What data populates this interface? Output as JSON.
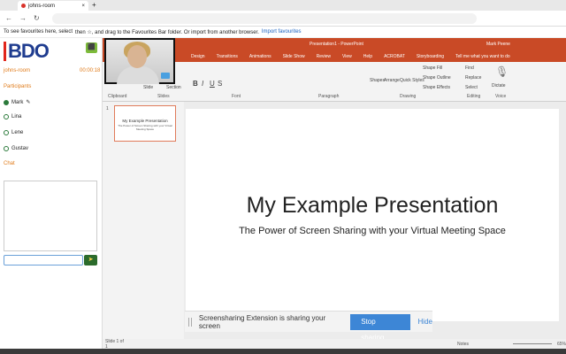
{
  "browser": {
    "tab_title": "johns-room",
    "back_icon": "←",
    "forward_icon": "→",
    "reload_icon": "↻",
    "fav_text": "To see favourites here, select",
    "fav_text2": "then ☆, and drag to the Favourites Bar folder. Or import from another browser.",
    "fav_link": "Import favourites"
  },
  "sidebar": {
    "logo": "BDO",
    "room": "johns-room",
    "timer": "00:00:18",
    "participants_label": "Participants",
    "participants": [
      "Mark",
      "Lina",
      "Lene",
      "Gustav"
    ],
    "chat_label": "Chat"
  },
  "ppt": {
    "title": "Presentation1 - PowerPoint",
    "user": "Mark Peene",
    "tabs": [
      "Design",
      "Transitions",
      "Animations",
      "Slide Show",
      "Review",
      "View",
      "Help",
      "ACROBAT",
      "Storyboarding"
    ],
    "tell_me": "Tell me what you want to do",
    "groups": [
      "Clipboard",
      "Slides",
      "Font",
      "Paragraph",
      "Drawing",
      "Editing",
      "Voice"
    ],
    "ribbon_labels": [
      "Slide",
      "Section",
      "Shapes",
      "Arrange",
      "Quick Styles",
      "Shape Fill",
      "Shape Outline",
      "Shape Effects",
      "Find",
      "Replace",
      "Select",
      "Dictate"
    ],
    "slide_number": "1",
    "status_left": "Slide 1 of 1",
    "status_notes": "Notes",
    "zoom": "65%"
  },
  "slide": {
    "title": "My Example Presentation",
    "subtitle": "The Power of Screen Sharing with your Virtual Meeting Space"
  },
  "share": {
    "text": "Screensharing Extension is sharing your screen",
    "stop": "Stop sharing",
    "hide": "Hide"
  }
}
